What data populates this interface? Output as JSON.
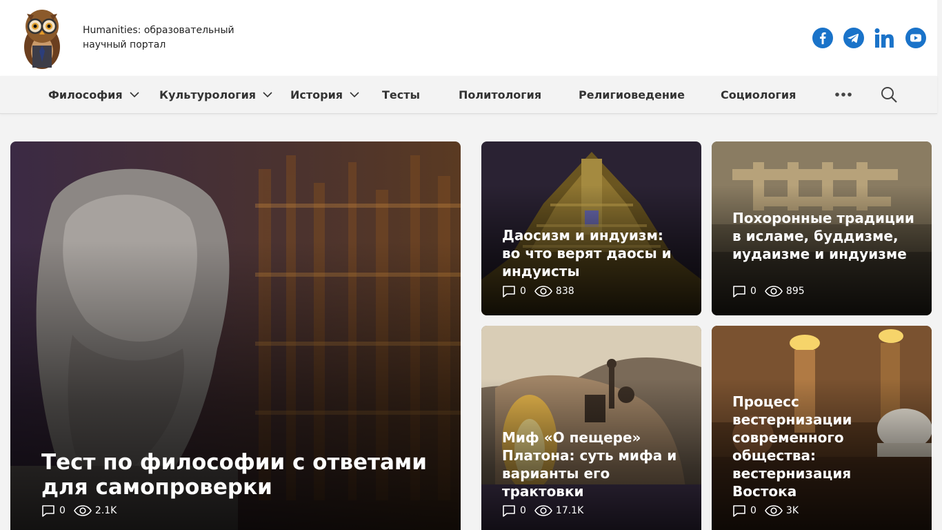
{
  "header": {
    "tagline": "Humanities: образовательный научный портал",
    "logo_icon": "owl-logo",
    "socials": [
      {
        "name": "facebook-icon",
        "color": "#1a73c9"
      },
      {
        "name": "telegram-icon",
        "color": "#1a73c9"
      },
      {
        "name": "linkedin-icon",
        "color": "#1a73c9"
      },
      {
        "name": "youtube-icon",
        "color": "#1a73c9"
      }
    ]
  },
  "nav": {
    "items": [
      {
        "label": "Философия",
        "dropdown": true
      },
      {
        "label": "Культурология",
        "dropdown": true
      },
      {
        "label": "История",
        "dropdown": true
      },
      {
        "label": "Тесты",
        "dropdown": false
      },
      {
        "label": "Политология",
        "dropdown": false
      },
      {
        "label": "Религиоведение",
        "dropdown": false
      },
      {
        "label": "Социология",
        "dropdown": false
      }
    ],
    "more_icon": "more-dots-icon",
    "search_icon": "search-icon"
  },
  "cards": [
    {
      "title": "Тест по философии с ответами для самопроверки",
      "comments": "0",
      "views": "2.1K"
    },
    {
      "title": "Даосизм и индуизм: во что верят даосы и индуисты",
      "comments": "0",
      "views": "838"
    },
    {
      "title": "Похоронные традиции в исламе, буддизме, иудаизме и индуизме",
      "comments": "0",
      "views": "895"
    },
    {
      "title": "Миф «О пещере» Платона: суть мифа и варианты его трактовки",
      "comments": "0",
      "views": "17.1K"
    },
    {
      "title": "Процесс вестернизации современного общества: вестернизация Востока",
      "comments": "0",
      "views": "3K"
    }
  ],
  "colors": {
    "accent": "#1a73c9",
    "nav_bg": "#f3f3f3",
    "page_bg": "#f3f3f3"
  }
}
